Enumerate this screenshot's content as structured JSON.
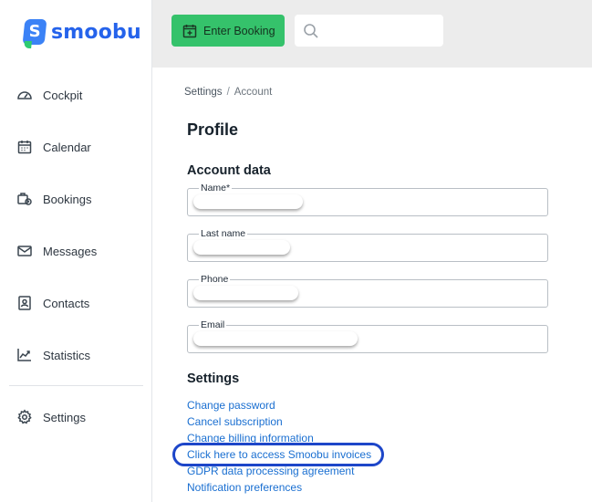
{
  "brand": {
    "name": "smoobu",
    "mark": "S"
  },
  "sidebar": {
    "items": [
      {
        "label": "Cockpit",
        "icon": "gauge-icon"
      },
      {
        "label": "Calendar",
        "icon": "calendar-icon"
      },
      {
        "label": "Bookings",
        "icon": "bookings-icon"
      },
      {
        "label": "Messages",
        "icon": "envelope-icon"
      },
      {
        "label": "Contacts",
        "icon": "contact-card-icon"
      },
      {
        "label": "Statistics",
        "icon": "chart-icon"
      },
      {
        "label": "Settings",
        "icon": "gear-icon"
      }
    ]
  },
  "topbar": {
    "enter_booking_label": "Enter Booking",
    "search_placeholder": ""
  },
  "breadcrumb": {
    "parent": "Settings",
    "separator": "/",
    "current": "Account"
  },
  "page_title": "Profile",
  "account_data": {
    "title": "Account data",
    "fields": [
      {
        "label": "Name*"
      },
      {
        "label": "Last name"
      },
      {
        "label": "Phone"
      },
      {
        "label": "Email"
      }
    ]
  },
  "settings": {
    "title": "Settings",
    "links": [
      "Change password",
      "Cancel subscription",
      "Change billing information",
      "Click here to access Smoobu invoices",
      "GDPR data processing agreement",
      "Notification preferences"
    ]
  },
  "colors": {
    "accent_green": "#35c26b",
    "link_blue": "#1a6fd1",
    "brand_blue": "#2563eb",
    "highlight": "#1d46c9"
  }
}
